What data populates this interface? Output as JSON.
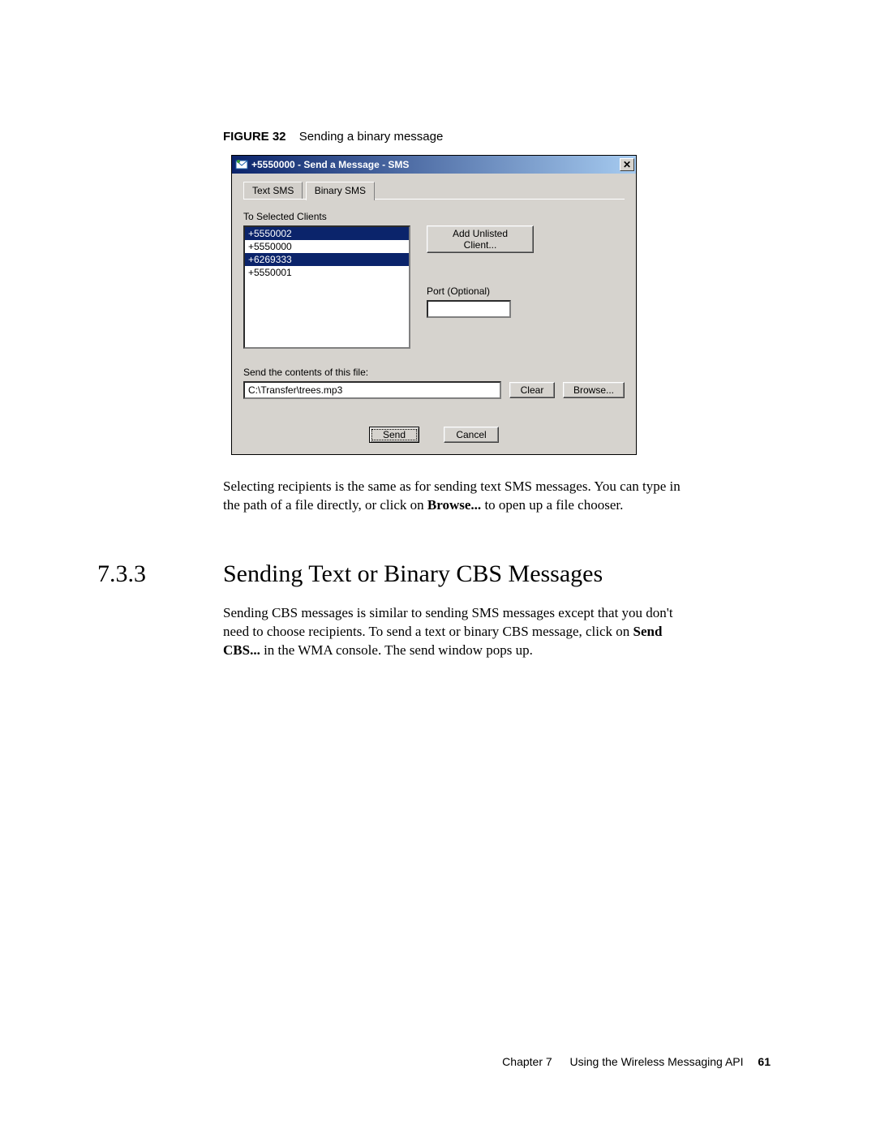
{
  "figure": {
    "label": "FIGURE 32",
    "caption": "Sending a binary message"
  },
  "dialog": {
    "title": "+5550000 - Send a Message - SMS",
    "close_glyph": "✕",
    "tabs": {
      "text_sms": "Text SMS",
      "binary_sms": "Binary SMS"
    },
    "to_label": "To Selected Clients",
    "clients": {
      "c0": "+5550002",
      "c1": "+5550000",
      "c2": "+6269333",
      "c3": "+5550001"
    },
    "add_unlisted": "Add Unlisted Client...",
    "port_label": "Port (Optional)",
    "port_value": "",
    "file_label": "Send the contents of this file:",
    "file_value": "C:\\Transfer\\trees.mp3",
    "clear": "Clear",
    "browse": "Browse...",
    "send": "Send",
    "cancel": "Cancel"
  },
  "para1": {
    "t0": "Selecting recipients is the same as for sending text SMS messages. You can type in the path of a file directly, or click on ",
    "bold": "Browse...",
    "t1": " to open up a file chooser."
  },
  "section": {
    "num": "7.3.3",
    "title": "Sending Text or Binary CBS Messages"
  },
  "para2": {
    "t0": "Sending CBS messages is similar to sending SMS messages except that you don't need to choose recipients. To send a text or binary CBS message, click on ",
    "bold": "Send CBS...",
    "t1": " in the WMA console. The send window pops up."
  },
  "footer": {
    "chapter_label": "Chapter 7",
    "chapter_title": "Using the Wireless Messaging API",
    "page": "61"
  }
}
